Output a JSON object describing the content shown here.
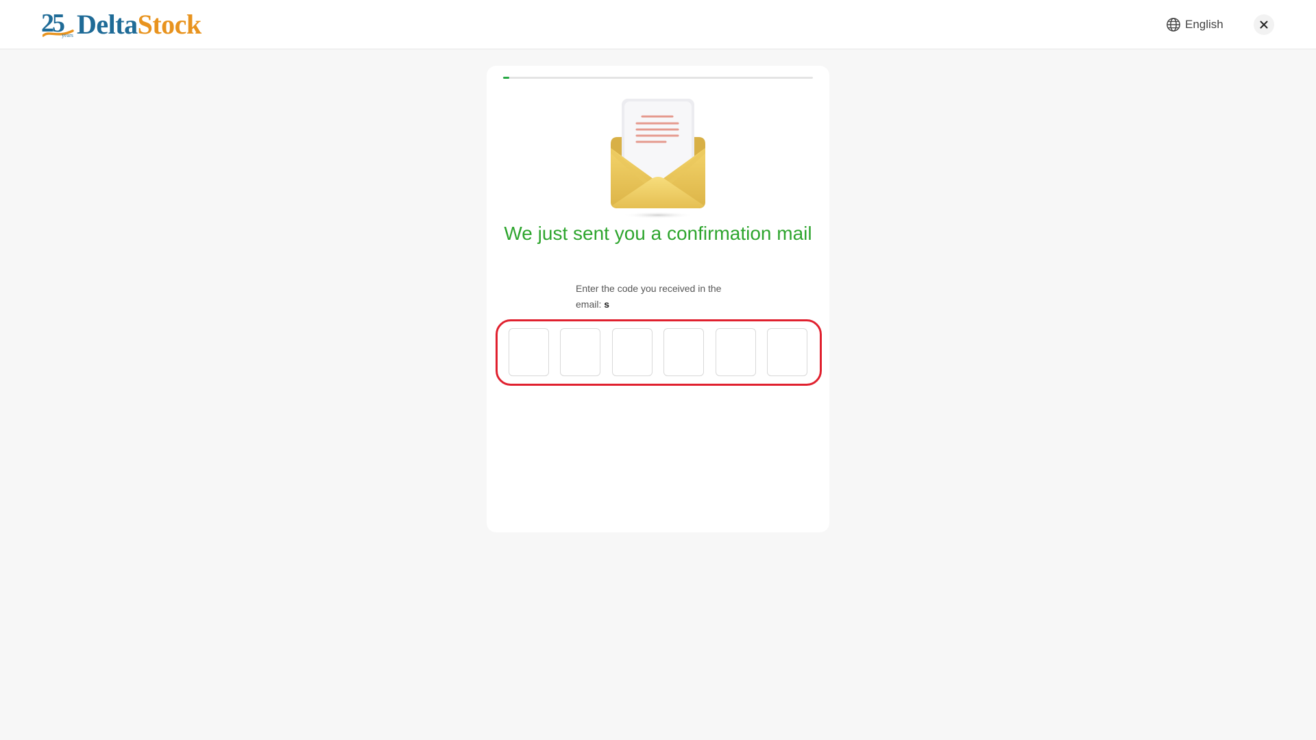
{
  "header": {
    "logo": {
      "badge_number": "25",
      "badge_caption": "years",
      "brand_part1": "Delta",
      "brand_part2": "Stock"
    },
    "language_label": "English",
    "icons": {
      "language": "globe-icon",
      "close": "close-icon"
    }
  },
  "card": {
    "progress_fraction": 0.02,
    "illustration": "open-envelope-with-letter",
    "heading": "We just sent you a confirmation mail",
    "instruction": "Enter the code you received in the email:",
    "email": "s",
    "code_inputs": [
      {
        "value": ""
      },
      {
        "value": ""
      },
      {
        "value": ""
      },
      {
        "value": ""
      },
      {
        "value": ""
      },
      {
        "value": ""
      }
    ]
  },
  "colors": {
    "brand_blue": "#1f6b97",
    "brand_orange": "#e8931e",
    "accent_green": "#2ea52e",
    "progress_green": "#27a844",
    "highlight_red": "#e0202e",
    "page_background": "#f7f7f7"
  }
}
